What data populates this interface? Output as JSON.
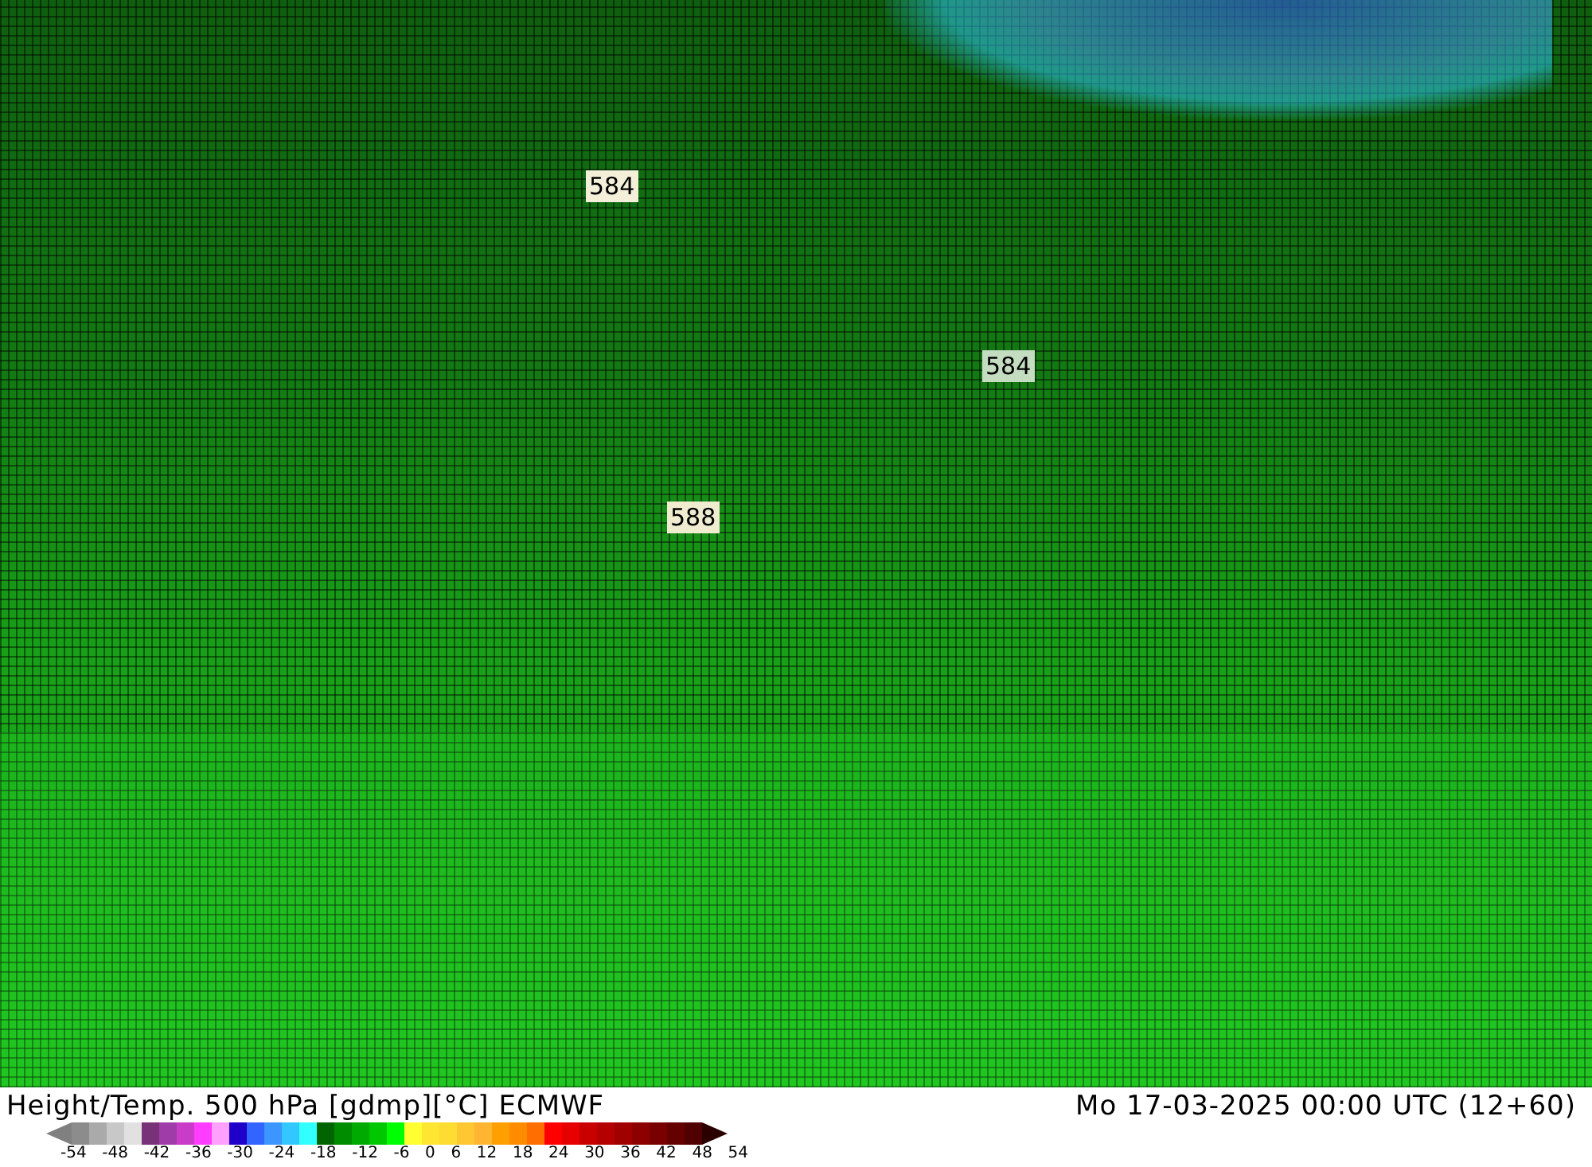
{
  "map": {
    "contour_labels": [
      "584",
      "584",
      "588"
    ]
  },
  "footer": {
    "title": "Height/Temp. 500 hPa [gdmp][°C] ECMWF",
    "valid_time": "Mo 17-03-2025 00:00 UTC (12+60)"
  },
  "legend": {
    "swatches": [
      {
        "color": "#8c8c8c"
      },
      {
        "color": "#aaaaaa"
      },
      {
        "color": "#c8c8c8"
      },
      {
        "color": "#e1e1e1"
      },
      {
        "color": "#783278"
      },
      {
        "color": "#a03ca8"
      },
      {
        "color": "#c83cc8"
      },
      {
        "color": "#ff3cff"
      },
      {
        "color": "#ffa0ff"
      },
      {
        "color": "#1e00c8"
      },
      {
        "color": "#3264ff"
      },
      {
        "color": "#3c96ff"
      },
      {
        "color": "#32c8ff"
      },
      {
        "color": "#32ffff"
      },
      {
        "color": "#006400"
      },
      {
        "color": "#008c00"
      },
      {
        "color": "#00aa00"
      },
      {
        "color": "#00c800"
      },
      {
        "color": "#00ff00"
      },
      {
        "color": "#ffff32"
      },
      {
        "color": "#ffe632"
      },
      {
        "color": "#ffdc32"
      },
      {
        "color": "#ffc832"
      },
      {
        "color": "#ffb432"
      },
      {
        "color": "#ffa000"
      },
      {
        "color": "#ff8c00"
      },
      {
        "color": "#ff6e00"
      },
      {
        "color": "#ff0000"
      },
      {
        "color": "#e60000"
      },
      {
        "color": "#c80000"
      },
      {
        "color": "#b40000"
      },
      {
        "color": "#a00000"
      },
      {
        "color": "#8c0000"
      },
      {
        "color": "#780000"
      },
      {
        "color": "#640000"
      },
      {
        "color": "#500000"
      }
    ],
    "ticks": [
      "-54",
      "-48",
      "-42",
      "-36",
      "-30",
      "-24",
      "-18",
      "-12",
      "-6",
      "0",
      "6",
      "12",
      "18",
      "24",
      "30",
      "36",
      "42",
      "48",
      "54"
    ]
  }
}
